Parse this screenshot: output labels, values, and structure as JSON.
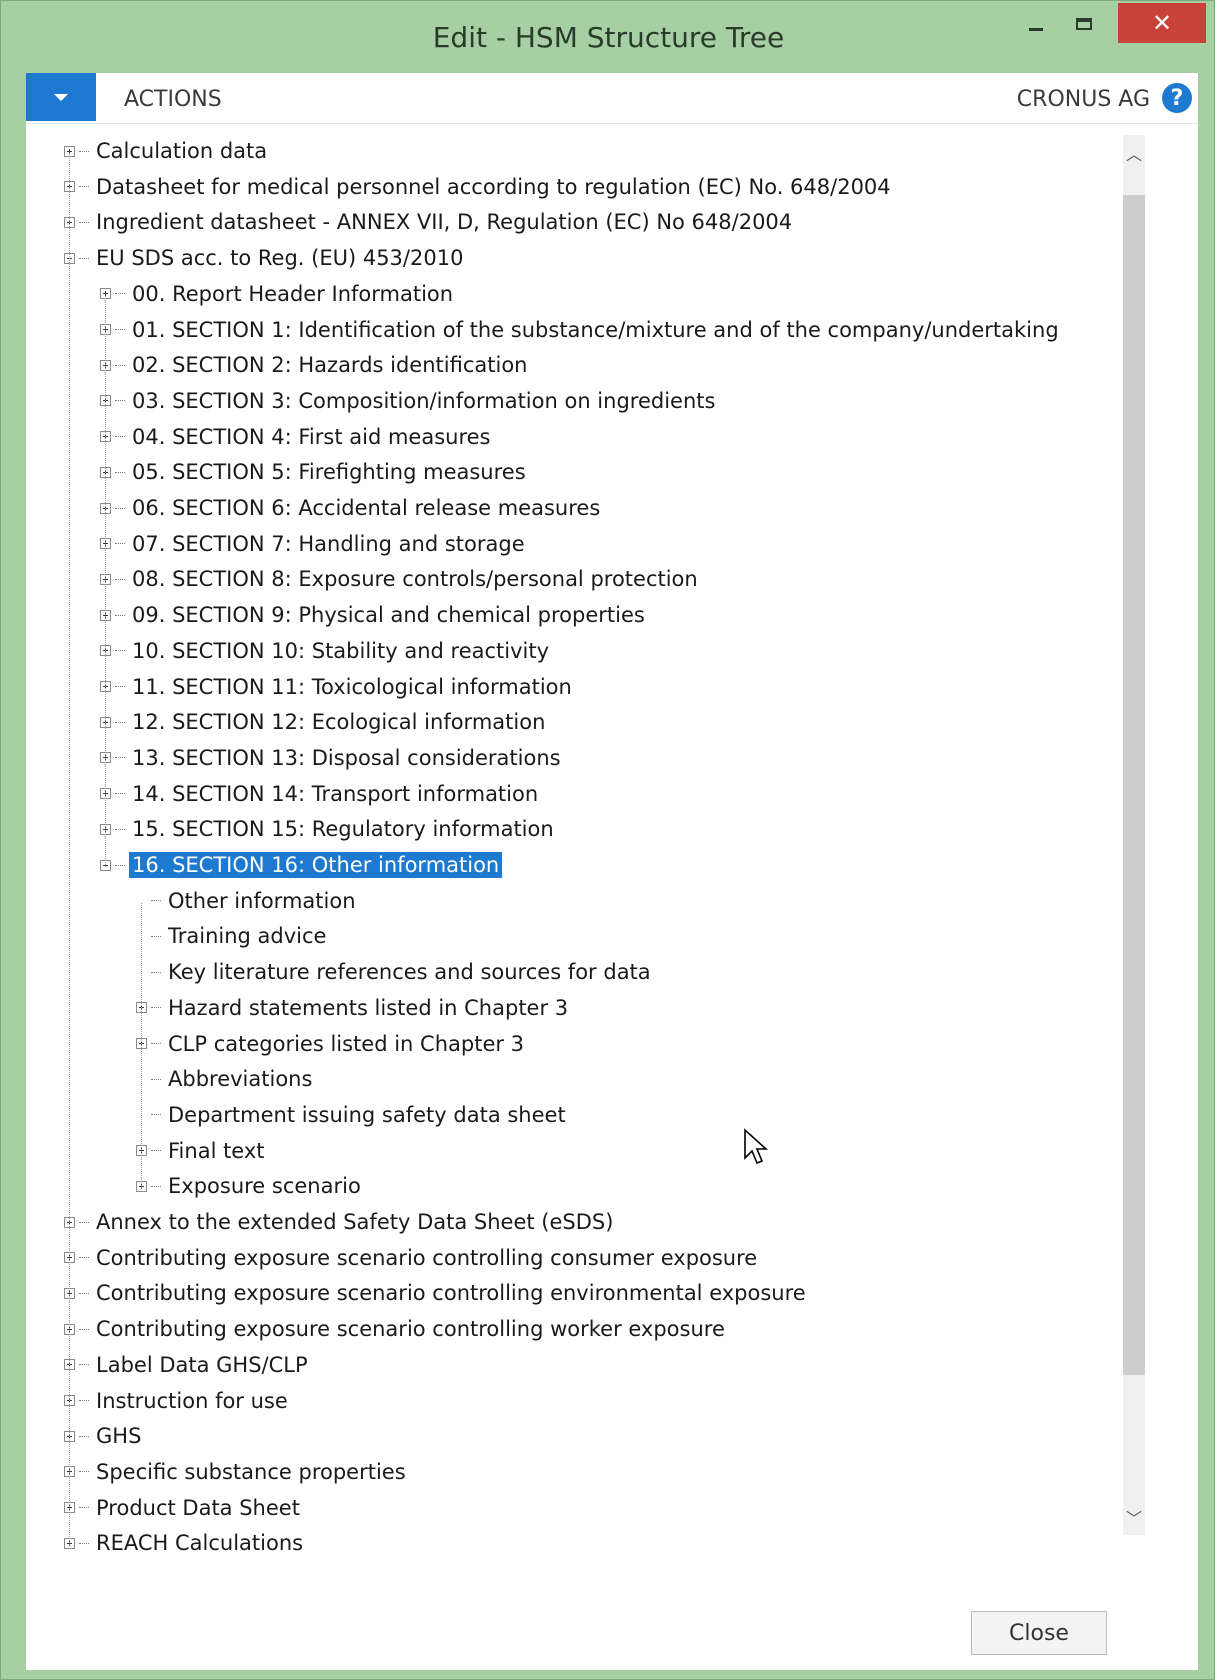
{
  "window": {
    "title": "Edit - HSM Structure Tree",
    "close_glyph": "✕"
  },
  "actionbar": {
    "actions_label": "ACTIONS",
    "company": "CRONUS AG",
    "help_glyph": "?"
  },
  "tree": {
    "top_items_before": [
      {
        "label": "Calculation data",
        "toggle": "plus"
      },
      {
        "label": "Datasheet for medical personnel according to regulation (EC) No. 648/2004",
        "toggle": "plus"
      },
      {
        "label": "Ingredient datasheet - ANNEX VII, D, Regulation (EC) No 648/2004",
        "toggle": "plus"
      },
      {
        "label": "EU SDS acc. to Reg. (EU) 453/2010",
        "toggle": "minus"
      }
    ],
    "sections": [
      {
        "label": "00. Report Header Information"
      },
      {
        "label": "01. SECTION 1: Identification of the substance/mixture and of the company/undertaking"
      },
      {
        "label": "02. SECTION 2: Hazards identification"
      },
      {
        "label": "03. SECTION 3: Composition/information on ingredients"
      },
      {
        "label": "04. SECTION 4: First aid measures"
      },
      {
        "label": "05. SECTION 5: Firefighting measures"
      },
      {
        "label": "06. SECTION 6: Accidental release measures"
      },
      {
        "label": "07. SECTION 7: Handling and storage"
      },
      {
        "label": "08. SECTION 8: Exposure controls/personal protection"
      },
      {
        "label": "09. SECTION 9: Physical and chemical properties"
      },
      {
        "label": "10. SECTION 10: Stability and reactivity"
      },
      {
        "label": "11. SECTION 11: Toxicological information"
      },
      {
        "label": "12. SECTION 12: Ecological information"
      },
      {
        "label": "13. SECTION 13: Disposal considerations"
      },
      {
        "label": "14. SECTION 14: Transport information"
      },
      {
        "label": "15. SECTION 15: Regulatory information"
      },
      {
        "label": "16. SECTION 16: Other information"
      }
    ],
    "section16_children": [
      {
        "label": "Other information",
        "toggle": "none"
      },
      {
        "label": "Training advice",
        "toggle": "none"
      },
      {
        "label": "Key literature references and sources for data",
        "toggle": "none"
      },
      {
        "label": "Hazard statements listed in Chapter 3",
        "toggle": "plus"
      },
      {
        "label": "CLP categories listed in Chapter 3",
        "toggle": "plus"
      },
      {
        "label": "Abbreviations",
        "toggle": "none"
      },
      {
        "label": "Department issuing safety data sheet",
        "toggle": "none"
      },
      {
        "label": "Final text",
        "toggle": "plus"
      },
      {
        "label": "Exposure scenario",
        "toggle": "plus"
      }
    ],
    "top_items_after": [
      {
        "label": "Annex to the extended Safety Data Sheet (eSDS)"
      },
      {
        "label": "Contributing exposure scenario controlling consumer exposure"
      },
      {
        "label": "Contributing exposure scenario controlling environmental exposure"
      },
      {
        "label": "Contributing exposure scenario controlling worker exposure"
      },
      {
        "label": "Label Data GHS/CLP"
      },
      {
        "label": "Instruction for use"
      },
      {
        "label": "GHS"
      },
      {
        "label": "Specific substance properties"
      },
      {
        "label": "Product Data Sheet"
      },
      {
        "label": "REACH Calculations"
      }
    ],
    "selected_label": "16. SECTION 16: Other information"
  },
  "footer": {
    "close_label": "Close"
  },
  "colors": {
    "frame": "#a6d0a3",
    "accent": "#1e7ad0",
    "close_red": "#c7423b"
  }
}
